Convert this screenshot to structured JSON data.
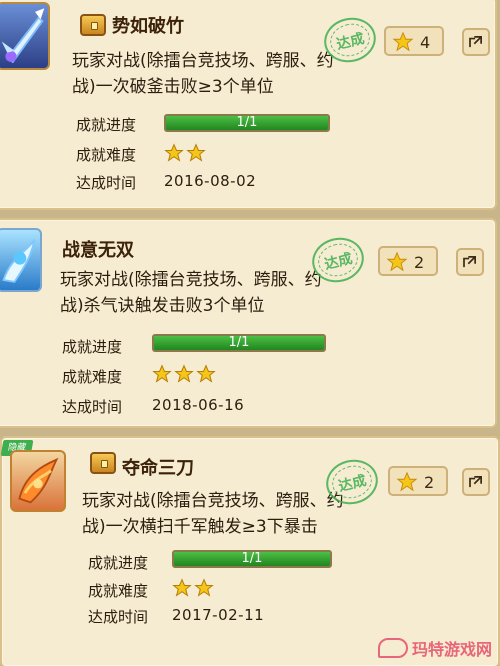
{
  "achievements": [
    {
      "title": "势如破竹",
      "has_chest": true,
      "description_line1": "玩家对战(除擂台竞技场、跨服、约",
      "description_line2": "战)一次破釜击败≥3个单位",
      "progress_label": "成就进度",
      "progress_text": "1/1",
      "progress_fraction": 1.0,
      "difficulty_label": "成就难度",
      "difficulty_stars": 2,
      "date_label": "达成时间",
      "date": "2016-08-02",
      "reward_count": "4",
      "stamp_text": "达成",
      "icon": "ice-sword-icon"
    },
    {
      "title": "战意无双",
      "has_chest": false,
      "description_line1": "玩家对战(除擂台竞技场、跨服、约",
      "description_line2": "战)杀气诀触发击败3个单位",
      "progress_label": "成就进度",
      "progress_text": "1/1",
      "progress_fraction": 1.0,
      "difficulty_label": "成就难度",
      "difficulty_stars": 3,
      "date_label": "达成时间",
      "date": "2018-06-16",
      "reward_count": "2",
      "stamp_text": "达成",
      "icon": "ice-phoenix-icon"
    },
    {
      "title": "夺命三刀",
      "has_chest": true,
      "description_line1": "玩家对战(除擂台竞技场、跨服、约",
      "description_line2": "战)一次横扫千军触发≥3下暴击",
      "progress_label": "成就进度",
      "progress_text": "1/1",
      "progress_fraction": 1.0,
      "difficulty_label": "成就难度",
      "difficulty_stars": 2,
      "date_label": "达成时间",
      "date": "2017-02-11",
      "reward_count": "2",
      "stamp_text": "达成",
      "ribbon_text": "隐藏",
      "icon": "fire-phoenix-icon"
    }
  ],
  "watermark": "玛特游戏网",
  "colors": {
    "progress_fill": "#2fa52a",
    "stamp": "#3fae4f",
    "star": "#f5c518",
    "watermark": "#e7667a"
  }
}
